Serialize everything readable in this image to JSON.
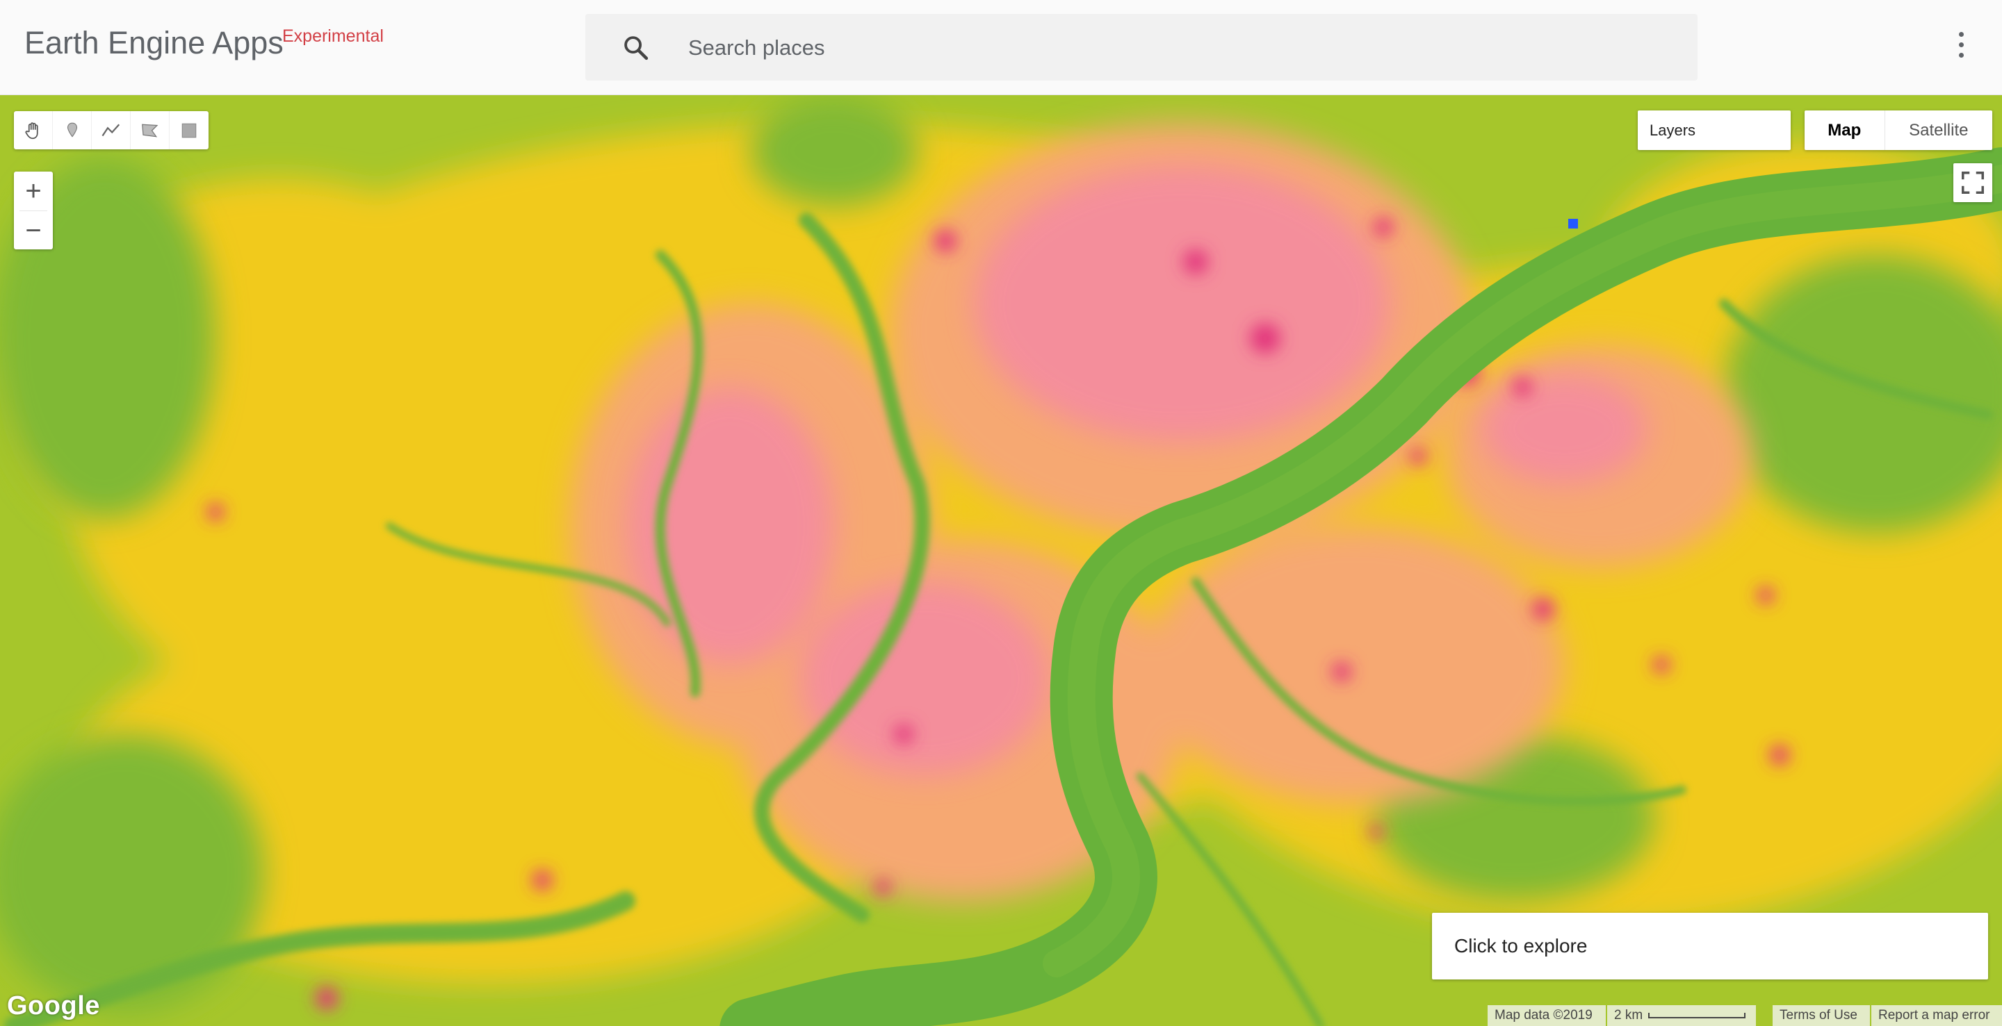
{
  "header": {
    "title": "Earth Engine Apps",
    "badge": "Experimental",
    "badge_color": "#d23f45",
    "search": {
      "placeholder": "Search places",
      "icon": "search-icon"
    },
    "menu_icon": "more-vert-icon"
  },
  "map": {
    "draw_tools": [
      {
        "icon": "hand-pan-icon"
      },
      {
        "icon": "marker-icon"
      },
      {
        "icon": "polyline-icon"
      },
      {
        "icon": "polygon-icon"
      },
      {
        "icon": "rectangle-icon"
      }
    ],
    "zoom": {
      "in_label": "+",
      "out_label": "−"
    },
    "layers_label": "Layers",
    "map_type": {
      "map_label": "Map",
      "satellite_label": "Satellite"
    },
    "fullscreen_icon": "fullscreen-icon",
    "explore_label": "Click to explore",
    "logo": "Google",
    "attribution": {
      "data": "Map data ©2019",
      "scale": "2 km",
      "terms": "Terms of Use",
      "report": "Report a map error"
    },
    "palette": {
      "river": "#6bb239",
      "vegetation": "#a8c929",
      "mid": "#f2cc1c",
      "urban": "#f6a36f",
      "urban_dense": "#f47fa3",
      "hotspot": "#e8337d"
    }
  }
}
